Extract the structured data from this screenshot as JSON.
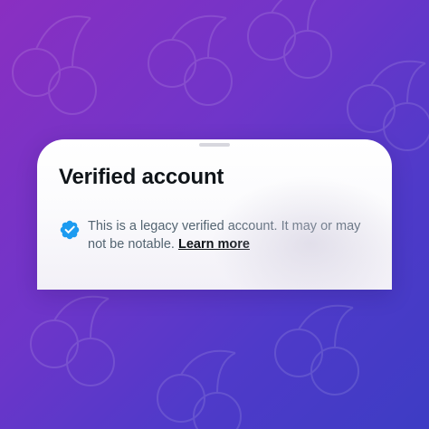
{
  "sheet": {
    "title": "Verified account",
    "description": "This is a legacy verified account. It may or may not be notable.",
    "learn_more": "Learn more",
    "badge_icon": "verified-badge-icon",
    "badge_color": "#1d9bf0"
  },
  "colors": {
    "background_start": "#8a2fc1",
    "background_end": "#3d3cc4",
    "title_text": "#0f1419",
    "body_text": "#536471"
  }
}
